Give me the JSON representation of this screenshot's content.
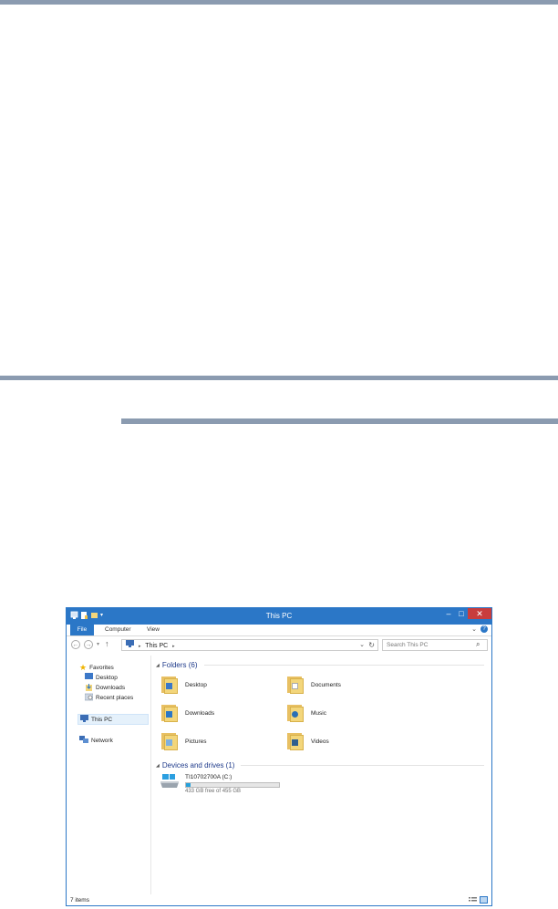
{
  "window": {
    "title": "This PC",
    "minimize_label": "–",
    "maximize_label": "□",
    "close_label": "✕"
  },
  "ribbon": {
    "tabs": [
      "File",
      "Computer",
      "View"
    ],
    "help_label": "?",
    "expand_label": "⌄"
  },
  "address": {
    "path": "This PC",
    "search_placeholder": "Search This PC"
  },
  "nav": {
    "favorites": "Favorites",
    "desktop": "Desktop",
    "downloads": "Downloads",
    "recent": "Recent places",
    "this_pc": "This PC",
    "network": "Network"
  },
  "folders": {
    "header": "Folders (6)",
    "items": [
      "Desktop",
      "Documents",
      "Downloads",
      "Music",
      "Pictures",
      "Videos"
    ]
  },
  "drives": {
    "header": "Devices and drives (1)",
    "name": "TI10702700A (C:)",
    "space": "433 GB free of 455 GB",
    "used_fraction": 0.048
  },
  "status": {
    "items": "7 items"
  },
  "colors": {
    "accent": "#2b77c7",
    "close": "#c83d3d",
    "rule": "#8b9bb0"
  }
}
